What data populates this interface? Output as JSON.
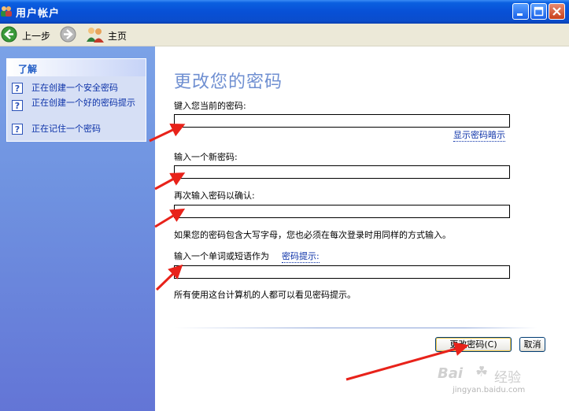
{
  "window": {
    "title": "用户帐户",
    "accent_color": "#0a54e0"
  },
  "toolbar": {
    "back_label": "上一步",
    "home_label": "主页",
    "back_icon": "back-arrow-icon",
    "forward_icon": "forward-arrow-icon",
    "home_icon": "users-home-icon"
  },
  "sidebar": {
    "section_title": "了解",
    "items": [
      {
        "label": "正在创建一个安全密码",
        "icon": "help-icon"
      },
      {
        "label": "正在创建一个好的密码提示",
        "icon": "help-icon"
      },
      {
        "label": "正在记住一个密码",
        "icon": "help-icon"
      }
    ]
  },
  "main": {
    "title": "更改您的密码",
    "current_password_label": "键入您当前的密码:",
    "current_password_value": "",
    "show_hint_link": "显示密码暗示",
    "new_password_label": "输入一个新密码:",
    "new_password_value": "",
    "confirm_password_label": "再次输入密码以确认:",
    "confirm_password_value": "",
    "case_note": "如果您的密码包含大写字母，您也必须在每次登录时用同样的方式输入。",
    "hint_label_prefix": "输入一个单词或短语作为",
    "hint_label_link": "密码提示:",
    "hint_value": "",
    "hint_note": "所有使用这台计算机的人都可以看见密码提示。"
  },
  "buttons": {
    "change_password": "更改密码(C)",
    "cancel": "取消"
  },
  "watermark": {
    "logo": "Bai",
    "text": "经验",
    "url": "jingyan.baidu.com"
  },
  "annotation_color": "#e8221a"
}
